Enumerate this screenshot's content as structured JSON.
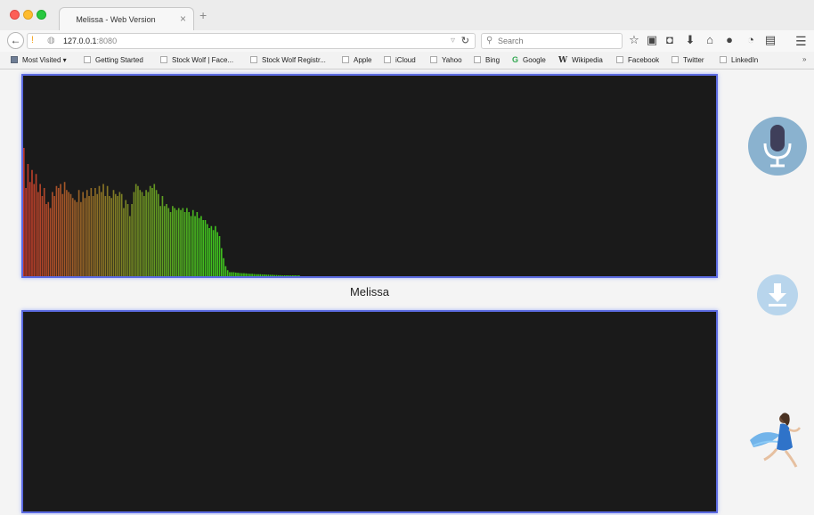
{
  "browser": {
    "tab": {
      "title": "Melissa - Web Version"
    },
    "url": {
      "host": "127.0.0.1",
      "port": ":8080"
    },
    "search": {
      "placeholder": "Search"
    },
    "bookmarks": [
      {
        "label": "Most Visited ▾",
        "icon": "folder-icon"
      },
      {
        "label": "Getting Started",
        "icon": "page-icon"
      },
      {
        "label": "Stock Wolf | Face...",
        "icon": "page-icon"
      },
      {
        "label": "Stock Wolf Registr...",
        "icon": "page-icon"
      },
      {
        "label": "Apple",
        "icon": "page-icon"
      },
      {
        "label": "iCloud",
        "icon": "page-icon"
      },
      {
        "label": "Yahoo",
        "icon": "page-icon"
      },
      {
        "label": "Bing",
        "icon": "page-icon"
      },
      {
        "label": "Google",
        "icon": "google-icon"
      },
      {
        "label": "Wikipedia",
        "icon": "wikipedia-icon"
      },
      {
        "label": "Facebook",
        "icon": "page-icon"
      },
      {
        "label": "Twitter",
        "icon": "page-icon"
      },
      {
        "label": "LinkedIn",
        "icon": "page-icon"
      }
    ],
    "bookmarks_overflow": "»"
  },
  "app": {
    "name": "Melissa",
    "panel_color": "#1a1a1a",
    "panel_border_color": "#5b6ae0",
    "mic_color": "#8ab2cf",
    "download_color": "#b8d5ec",
    "spectrum": {
      "levels": [
        0.64,
        0.44,
        0.56,
        0.47,
        0.53,
        0.46,
        0.51,
        0.42,
        0.46,
        0.4,
        0.44,
        0.36,
        0.37,
        0.34,
        0.42,
        0.4,
        0.45,
        0.44,
        0.46,
        0.41,
        0.47,
        0.43,
        0.42,
        0.41,
        0.39,
        0.38,
        0.37,
        0.43,
        0.37,
        0.42,
        0.39,
        0.43,
        0.4,
        0.44,
        0.4,
        0.44,
        0.41,
        0.45,
        0.42,
        0.46,
        0.4,
        0.45,
        0.4,
        0.39,
        0.43,
        0.41,
        0.4,
        0.42,
        0.41,
        0.34,
        0.38,
        0.36,
        0.3,
        0.36,
        0.42,
        0.46,
        0.45,
        0.43,
        0.42,
        0.4,
        0.43,
        0.42,
        0.45,
        0.44,
        0.46,
        0.43,
        0.41,
        0.35,
        0.4,
        0.35,
        0.36,
        0.34,
        0.32,
        0.35,
        0.34,
        0.33,
        0.34,
        0.33,
        0.34,
        0.32,
        0.34,
        0.32,
        0.3,
        0.33,
        0.3,
        0.32,
        0.29,
        0.3,
        0.28,
        0.28,
        0.26,
        0.24,
        0.25,
        0.23,
        0.25,
        0.22,
        0.2,
        0.14,
        0.09,
        0.05,
        0.03,
        0.02,
        0.02,
        0.02,
        0.018,
        0.017,
        0.016,
        0.015,
        0.015,
        0.014,
        0.013,
        0.012,
        0.012,
        0.011,
        0.01,
        0.01,
        0.01,
        0.009,
        0.009,
        0.008,
        0.008,
        0.007,
        0.007,
        0.006,
        0.006,
        0.005,
        0.005,
        0.004,
        0.004,
        0.003,
        0.003,
        0.002,
        0.002,
        0.002,
        0.001,
        0.001
      ],
      "color_low": "#c0392b",
      "color_high": "#3fbf1f"
    }
  }
}
